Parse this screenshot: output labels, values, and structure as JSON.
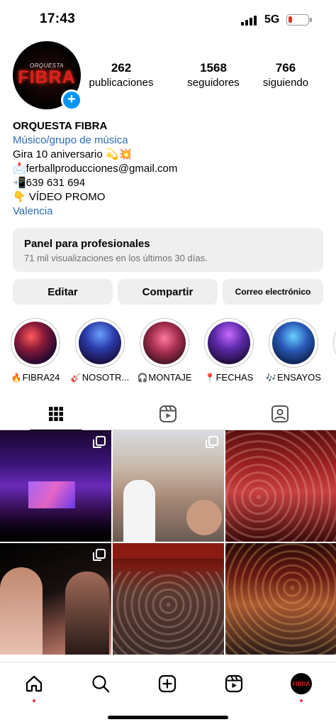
{
  "status_bar": {
    "time": "17:43",
    "network": "5G",
    "battery_level": 0.2
  },
  "profile": {
    "avatar_text_small": "ORQUESTA",
    "avatar_text_big": "FIBRA",
    "stats": [
      {
        "value": "262",
        "label": "publicaciones"
      },
      {
        "value": "1568",
        "label": "seguidores"
      },
      {
        "value": "766",
        "label": "siguiendo"
      }
    ],
    "name": "ORQUESTA FIBRA",
    "category": "Músico/grupo de música",
    "bio_lines": [
      "Gira 10 aniversario 💫💥",
      "📩ferballproducciones@gmail.com",
      "📲639 631 694",
      "👇 VÍDEO PROMO"
    ],
    "location": "Valencia"
  },
  "dashboard": {
    "title": "Panel para profesionales",
    "subtitle": "71 mil visualizaciones en los últimos 30 días."
  },
  "buttons": {
    "edit": "Editar",
    "share": "Compartir",
    "email": "Correo electrónico"
  },
  "highlights": [
    {
      "emoji": "🔥",
      "label": "FIBRA24"
    },
    {
      "emoji": "🎸",
      "label": "NOSOTR..."
    },
    {
      "emoji": "🎧",
      "label": "MONTAJE"
    },
    {
      "emoji": "📍",
      "label": "FECHAS"
    },
    {
      "emoji": "🎶",
      "label": "ENSAYOS"
    }
  ],
  "tabs": [
    {
      "icon": "grid-icon",
      "active": true
    },
    {
      "icon": "reels-icon",
      "active": false
    },
    {
      "icon": "tagged-icon",
      "active": false
    }
  ],
  "nav": [
    {
      "icon": "home-icon"
    },
    {
      "icon": "search-icon"
    },
    {
      "icon": "create-icon"
    },
    {
      "icon": "reels-icon"
    },
    {
      "icon": "profile-avatar",
      "text": "FIBRA"
    }
  ],
  "colors": {
    "link": "#2b6cb8",
    "accent": "#0095f6",
    "notification": "#ff3040"
  }
}
